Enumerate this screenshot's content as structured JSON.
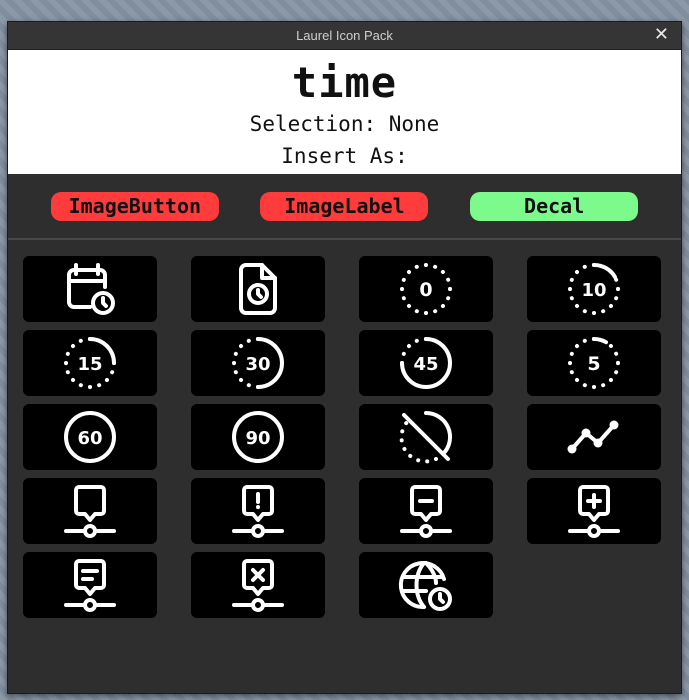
{
  "window": {
    "title": "Laurel Icon Pack",
    "close_glyph": "✕"
  },
  "header": {
    "title": "time",
    "selection_line": "Selection: None",
    "insert_line": "Insert As:"
  },
  "insert_types": [
    {
      "label": "ImageButton",
      "color": "#ff3b3b"
    },
    {
      "label": "ImageLabel",
      "color": "#ff3b3b"
    },
    {
      "label": "Decal",
      "color": "#7dfa8c"
    }
  ],
  "icons": [
    {
      "name": "calendar-time-icon"
    },
    {
      "name": "file-time-icon"
    },
    {
      "name": "time-duration-0-icon",
      "text": "0"
    },
    {
      "name": "time-duration-10-icon",
      "text": "10"
    },
    {
      "name": "time-duration-15-icon",
      "text": "15"
    },
    {
      "name": "time-duration-30-icon",
      "text": "30"
    },
    {
      "name": "time-duration-45-icon",
      "text": "45"
    },
    {
      "name": "time-duration-5-icon",
      "text": "5"
    },
    {
      "name": "time-duration-60-icon",
      "text": "60"
    },
    {
      "name": "time-duration-90-icon",
      "text": "90"
    },
    {
      "name": "time-duration-off-icon"
    },
    {
      "name": "timeline-icon"
    },
    {
      "name": "timeline-event-icon"
    },
    {
      "name": "timeline-event-exclamation-icon"
    },
    {
      "name": "timeline-event-minus-icon"
    },
    {
      "name": "timeline-event-plus-icon"
    },
    {
      "name": "timeline-event-text-icon"
    },
    {
      "name": "timeline-event-x-icon"
    },
    {
      "name": "world-time-icon"
    }
  ]
}
